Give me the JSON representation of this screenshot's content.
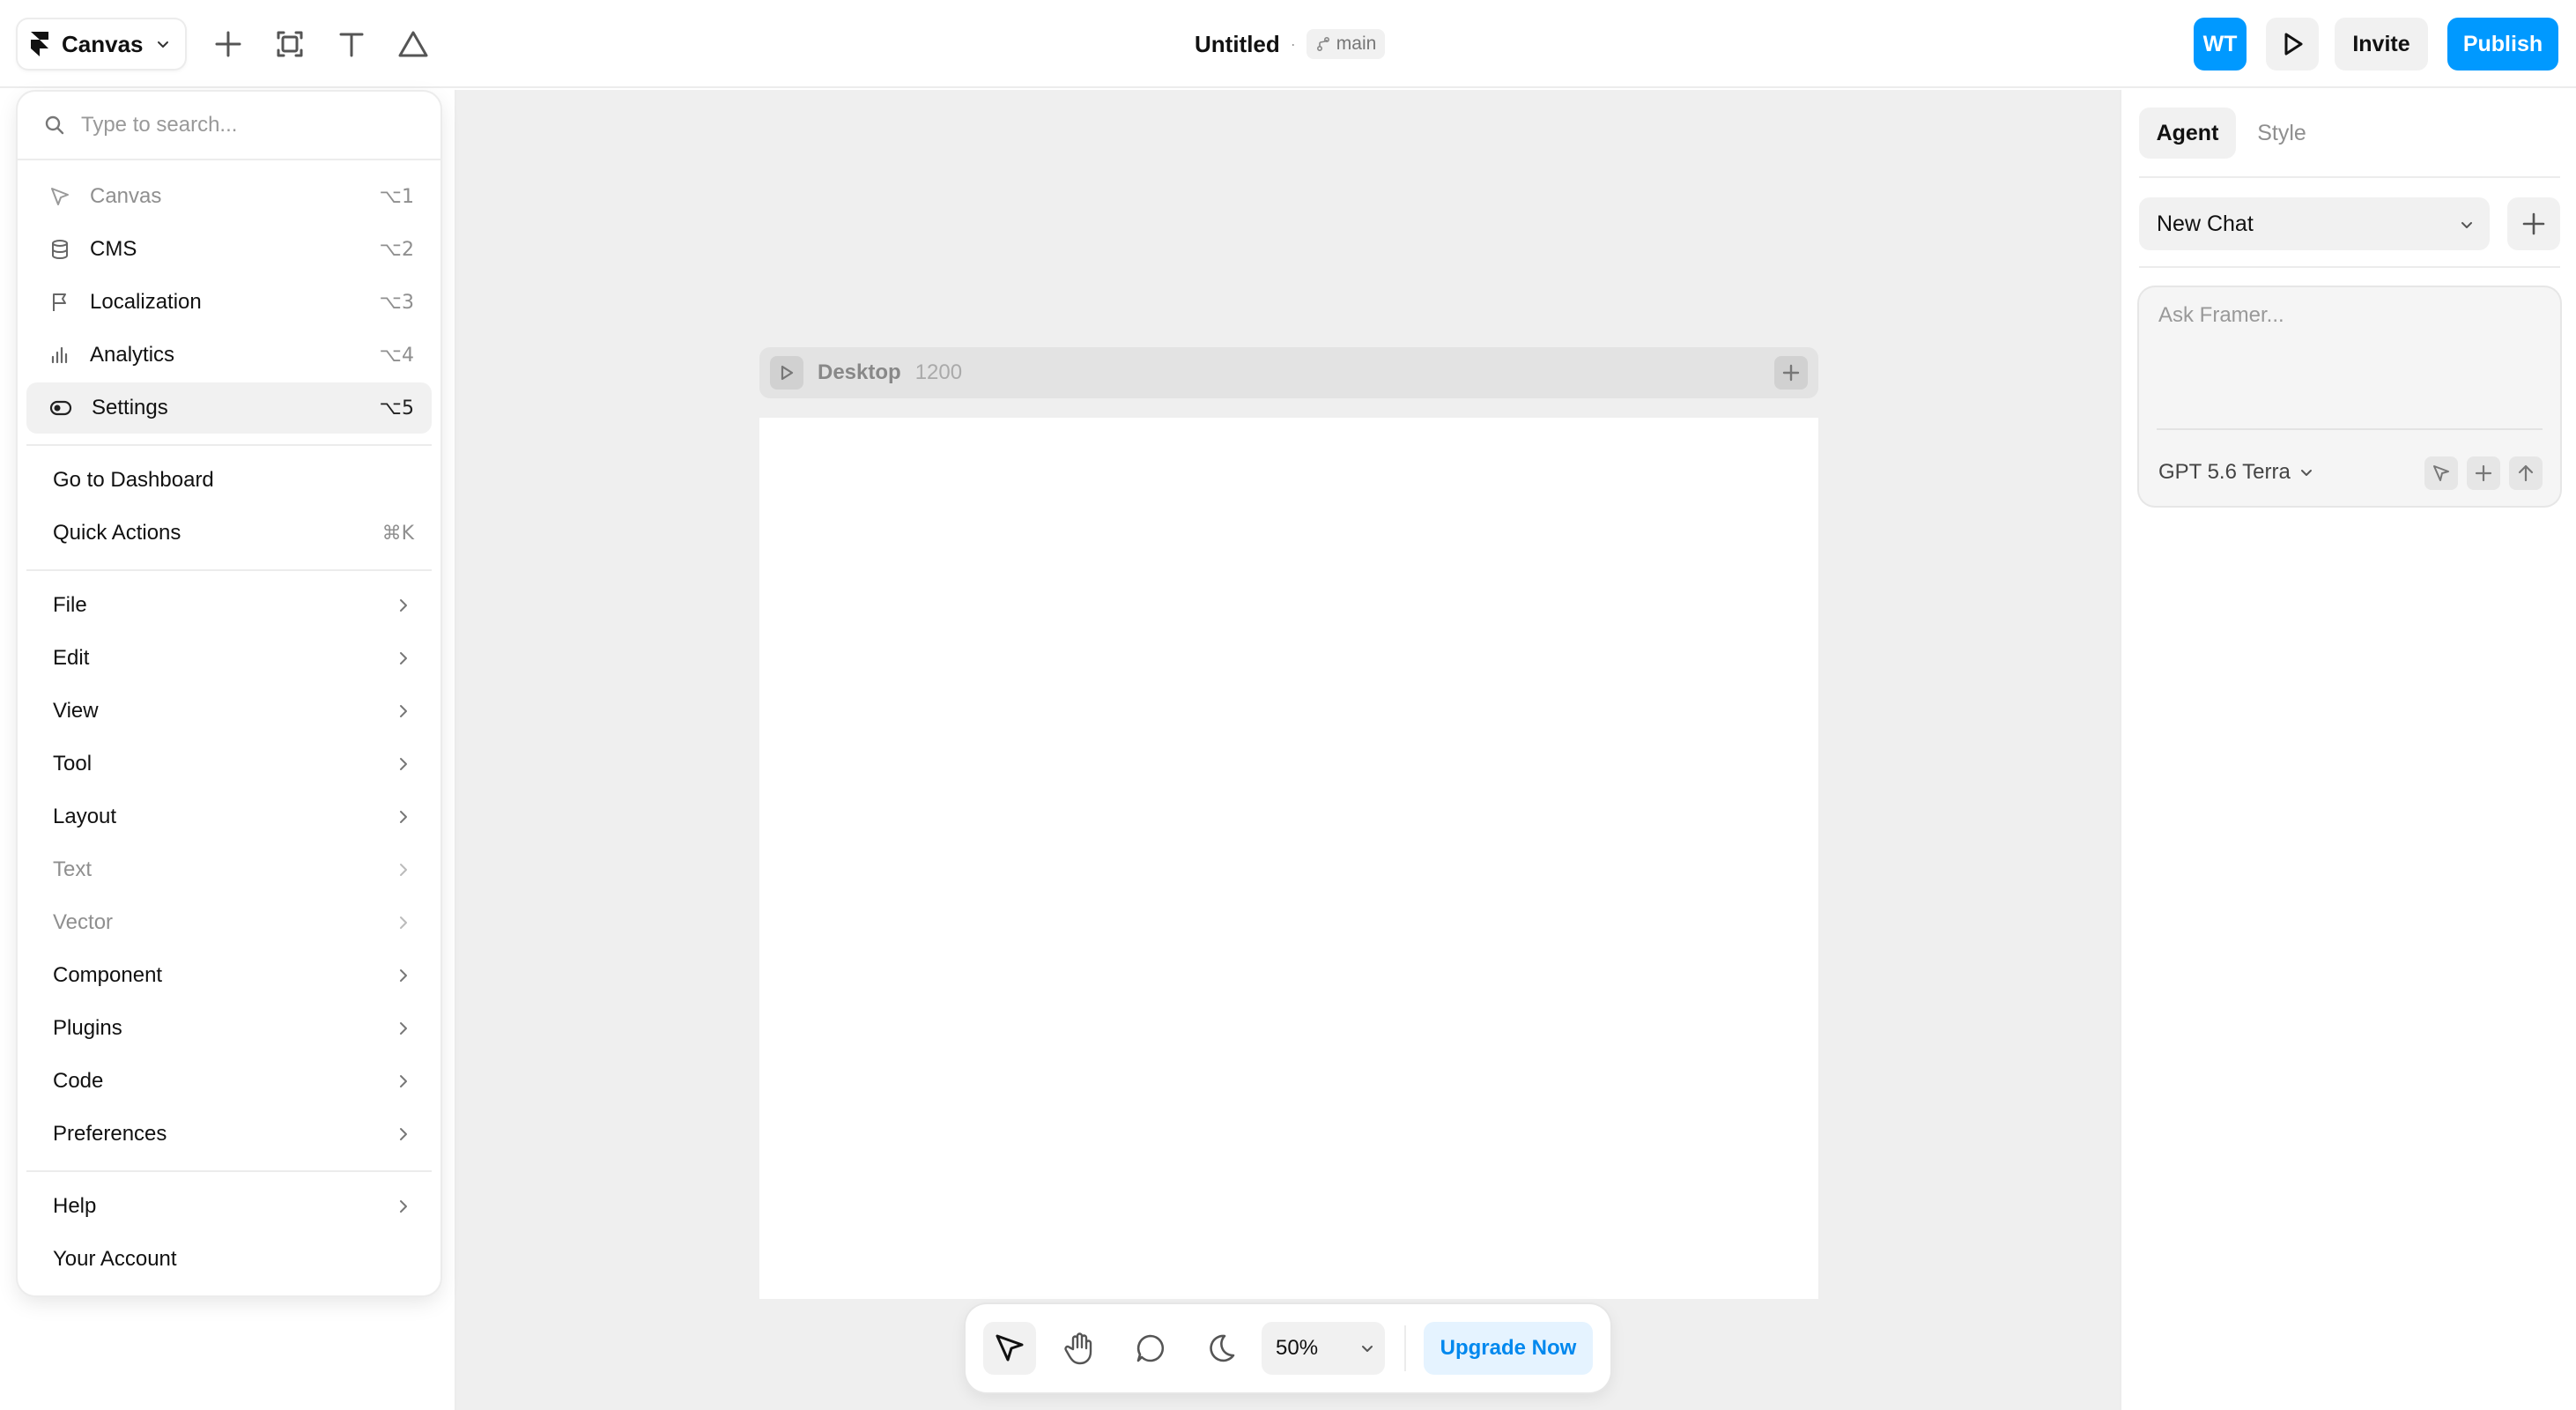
{
  "topbar": {
    "menu_button_label": "Canvas",
    "doc_title": "Untitled",
    "separator": "·",
    "branch": "main",
    "avatar_initials": "WT",
    "invite_label": "Invite",
    "publish_label": "Publish"
  },
  "menu": {
    "search_placeholder": "Type to search...",
    "nav_items": [
      {
        "label": "Canvas",
        "shortcut": "⌥1",
        "icon": "cursor-icon",
        "disabled": true
      },
      {
        "label": "CMS",
        "shortcut": "⌥2",
        "icon": "database-icon"
      },
      {
        "label": "Localization",
        "shortcut": "⌥3",
        "icon": "flag-icon"
      },
      {
        "label": "Analytics",
        "shortcut": "⌥4",
        "icon": "bar-chart-icon"
      },
      {
        "label": "Settings",
        "shortcut": "⌥5",
        "icon": "toggle-icon",
        "active": true
      }
    ],
    "dashboard_label": "Go to Dashboard",
    "quick_actions_label": "Quick Actions",
    "quick_actions_shortcut": "⌘K",
    "submenus": [
      {
        "label": "File"
      },
      {
        "label": "Edit"
      },
      {
        "label": "View"
      },
      {
        "label": "Tool"
      },
      {
        "label": "Layout"
      },
      {
        "label": "Text",
        "disabled": true
      },
      {
        "label": "Vector",
        "disabled": true
      },
      {
        "label": "Component"
      },
      {
        "label": "Plugins"
      },
      {
        "label": "Code"
      },
      {
        "label": "Preferences"
      }
    ],
    "help_label": "Help",
    "account_label": "Your Account"
  },
  "canvas": {
    "frame_name": "Desktop",
    "frame_width": "1200"
  },
  "toolbar": {
    "zoom": "50%",
    "upgrade_label": "Upgrade Now"
  },
  "right_panel": {
    "tab_agent": "Agent",
    "tab_style": "Style",
    "chat_select": "New Chat",
    "ask_placeholder": "Ask Framer...",
    "model": "GPT 5.6 Terra"
  },
  "colors": {
    "accent": "#0099ff",
    "canvas_bg": "#efefef",
    "upgrade_bg": "#e5f3ff"
  }
}
